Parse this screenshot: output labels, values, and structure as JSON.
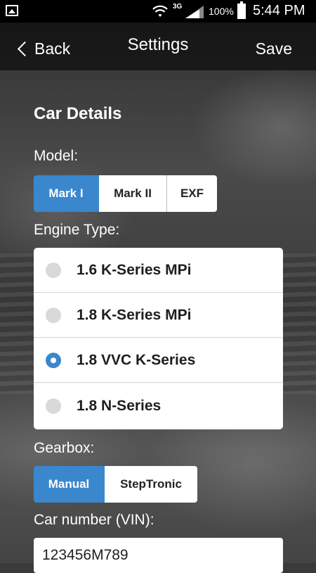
{
  "status_bar": {
    "network": "3G",
    "battery": "100%",
    "time": "5:44 PM"
  },
  "nav": {
    "back_label": "Back",
    "title": "Settings",
    "save_label": "Save"
  },
  "section_title": "Car Details",
  "model": {
    "label": "Model:",
    "options": [
      "Mark I",
      "Mark II",
      "EXF"
    ],
    "selected": "Mark I"
  },
  "engine": {
    "label": "Engine Type:",
    "options": [
      "1.6 K-Series MPi",
      "1.8 K-Series MPi",
      "1.8 VVC K-Series",
      "1.8 N-Series"
    ],
    "selected": "1.8 VVC K-Series"
  },
  "gearbox": {
    "label": "Gearbox:",
    "options": [
      "Manual",
      "StepTronic"
    ],
    "selected": "Manual"
  },
  "vin": {
    "label": "Car number (VIN):",
    "value": "123456M789"
  },
  "colors": {
    "accent": "#3a87cd",
    "status_bar": "#000000",
    "card": "#ffffff"
  },
  "icons": {
    "status_left": "gallery-icon",
    "wifi": "wifi-icon",
    "signal": "signal-icon",
    "battery": "battery-icon",
    "back": "chevron-left-icon"
  }
}
